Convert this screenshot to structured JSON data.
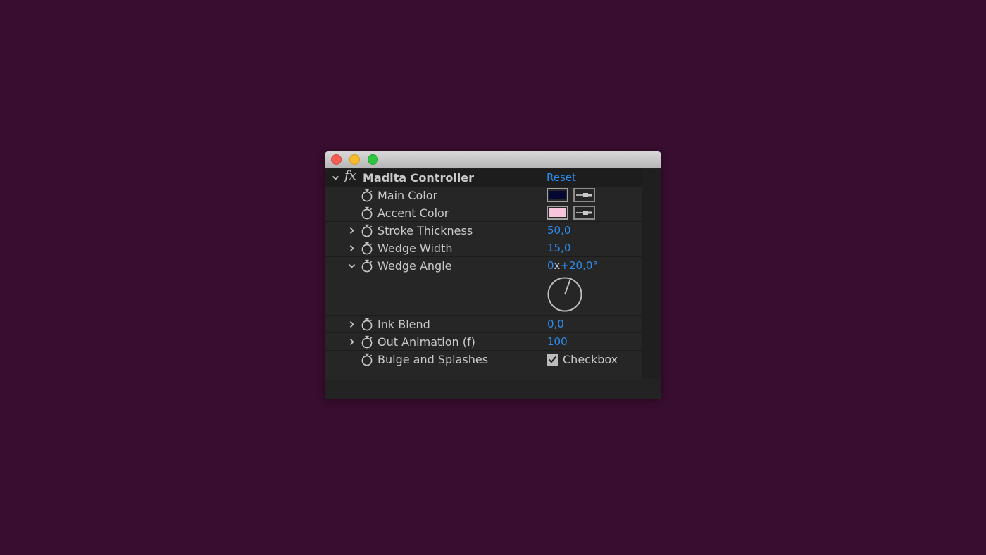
{
  "window": {
    "controls": [
      "close",
      "minimize",
      "maximize"
    ]
  },
  "effect": {
    "fx_icon": "fx",
    "name": "Madita Controller",
    "reset_label": "Reset"
  },
  "properties": [
    {
      "label": "Main Color",
      "type": "color",
      "color": "#040833"
    },
    {
      "label": "Accent Color",
      "type": "color",
      "color": "#f6c5dc"
    },
    {
      "label": "Stroke Thickness",
      "type": "number",
      "value": "50,0"
    },
    {
      "label": "Wedge Width",
      "type": "number",
      "value": "15,0"
    },
    {
      "label": "Wedge Angle",
      "type": "angle",
      "revolutions": "0",
      "separator": "x",
      "degrees": "+20,0°"
    },
    {
      "label": "Ink Blend",
      "type": "number",
      "value": "0,0"
    },
    {
      "label": "Out Animation (f)",
      "type": "number",
      "value": "100"
    },
    {
      "label": "Bulge and Splashes",
      "type": "checkbox",
      "checked": true,
      "checkbox_label": "Checkbox"
    }
  ],
  "colors": {
    "background": "#380d2f",
    "value_blue": "#2d8ceb",
    "panel": "#262626"
  }
}
